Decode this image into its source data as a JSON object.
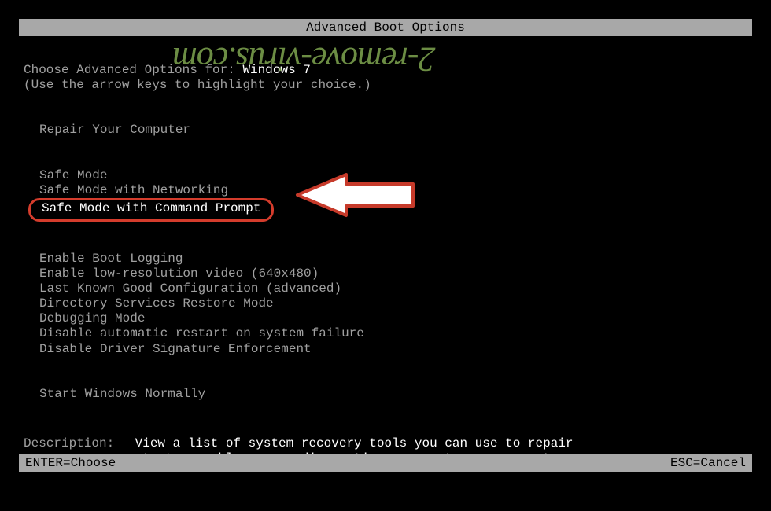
{
  "title": "Advanced Boot Options",
  "prompt": {
    "label": "Choose Advanced Options for: ",
    "os": "Windows 7"
  },
  "hint": "(Use the arrow keys to highlight your choice.)",
  "groups": {
    "repair": {
      "item": "Repair Your Computer"
    },
    "safe": {
      "item1": "Safe Mode",
      "item2": "Safe Mode with Networking",
      "item3": "Safe Mode with Command Prompt"
    },
    "advanced": {
      "item1": "Enable Boot Logging",
      "item2": "Enable low-resolution video (640x480)",
      "item3": "Last Known Good Configuration (advanced)",
      "item4": "Directory Services Restore Mode",
      "item5": "Debugging Mode",
      "item6": "Disable automatic restart on system failure",
      "item7": "Disable Driver Signature Enforcement"
    },
    "normal": {
      "item": "Start Windows Normally"
    }
  },
  "description": {
    "label": "Description:",
    "text": "View a list of system recovery tools you can use to repair startup problems, run diagnostics, or restore your system."
  },
  "footer": {
    "left": "ENTER=Choose",
    "right": "ESC=Cancel"
  },
  "watermark": "2-remove-virus.com",
  "colors": {
    "highlight_border": "#d43c2c",
    "watermark": "#7fa650",
    "bar_bg": "#a8a8a8",
    "bright_text": "#ffffff",
    "dim_text": "#a0a0a0"
  }
}
